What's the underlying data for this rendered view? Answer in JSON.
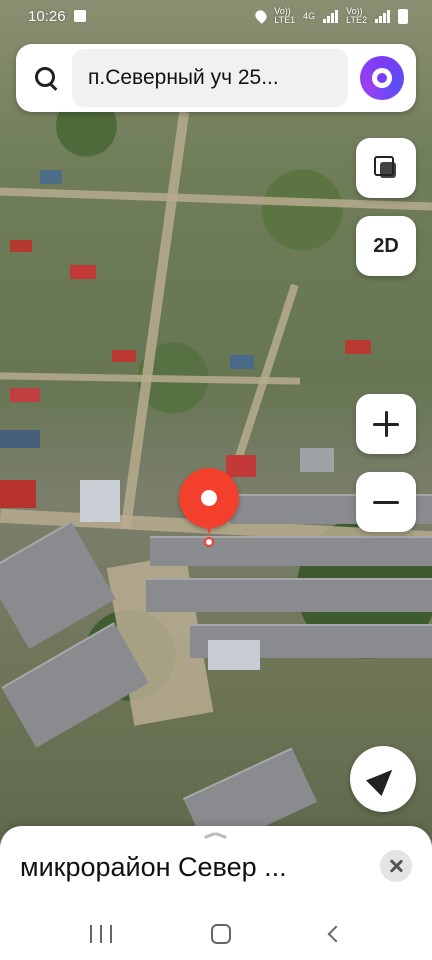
{
  "status_bar": {
    "time": "10:26",
    "net_left_top": "Vo))",
    "net_left_bottom": "LTE1",
    "net_gen": "4G",
    "net_right_top": "Vo))",
    "net_right_bottom": "LTE2"
  },
  "search": {
    "query": "п.Северный уч 25..."
  },
  "map_controls": {
    "mode_label": "2D"
  },
  "bottom_sheet": {
    "title": "микрорайон Север ..."
  },
  "colors": {
    "pin": "#f2402d",
    "assistant": "#7b3cf5"
  },
  "icons": [
    "search-icon",
    "alice-assistant-icon",
    "layers-icon",
    "plus-icon",
    "minus-icon",
    "location-arrow-icon",
    "close-icon",
    "chevron-up-icon"
  ]
}
